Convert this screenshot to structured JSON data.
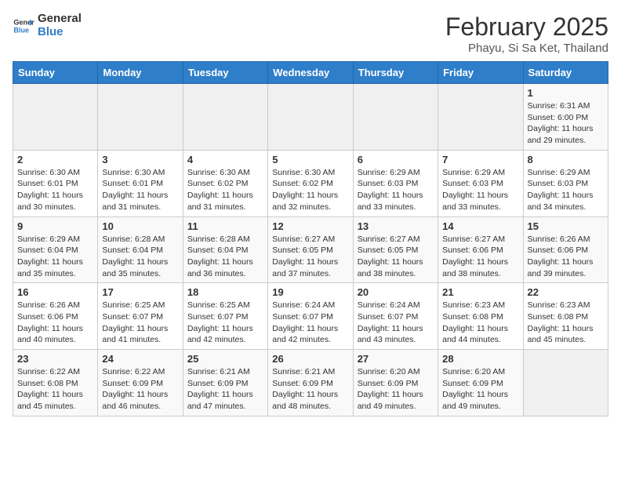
{
  "header": {
    "logo_general": "General",
    "logo_blue": "Blue",
    "title": "February 2025",
    "location": "Phayu, Si Sa Ket, Thailand"
  },
  "weekdays": [
    "Sunday",
    "Monday",
    "Tuesday",
    "Wednesday",
    "Thursday",
    "Friday",
    "Saturday"
  ],
  "weeks": [
    [
      {
        "day": "",
        "info": ""
      },
      {
        "day": "",
        "info": ""
      },
      {
        "day": "",
        "info": ""
      },
      {
        "day": "",
        "info": ""
      },
      {
        "day": "",
        "info": ""
      },
      {
        "day": "",
        "info": ""
      },
      {
        "day": "1",
        "info": "Sunrise: 6:31 AM\nSunset: 6:00 PM\nDaylight: 11 hours\nand 29 minutes."
      }
    ],
    [
      {
        "day": "2",
        "info": "Sunrise: 6:30 AM\nSunset: 6:01 PM\nDaylight: 11 hours\nand 30 minutes."
      },
      {
        "day": "3",
        "info": "Sunrise: 6:30 AM\nSunset: 6:01 PM\nDaylight: 11 hours\nand 31 minutes."
      },
      {
        "day": "4",
        "info": "Sunrise: 6:30 AM\nSunset: 6:02 PM\nDaylight: 11 hours\nand 31 minutes."
      },
      {
        "day": "5",
        "info": "Sunrise: 6:30 AM\nSunset: 6:02 PM\nDaylight: 11 hours\nand 32 minutes."
      },
      {
        "day": "6",
        "info": "Sunrise: 6:29 AM\nSunset: 6:03 PM\nDaylight: 11 hours\nand 33 minutes."
      },
      {
        "day": "7",
        "info": "Sunrise: 6:29 AM\nSunset: 6:03 PM\nDaylight: 11 hours\nand 33 minutes."
      },
      {
        "day": "8",
        "info": "Sunrise: 6:29 AM\nSunset: 6:03 PM\nDaylight: 11 hours\nand 34 minutes."
      }
    ],
    [
      {
        "day": "9",
        "info": "Sunrise: 6:29 AM\nSunset: 6:04 PM\nDaylight: 11 hours\nand 35 minutes."
      },
      {
        "day": "10",
        "info": "Sunrise: 6:28 AM\nSunset: 6:04 PM\nDaylight: 11 hours\nand 35 minutes."
      },
      {
        "day": "11",
        "info": "Sunrise: 6:28 AM\nSunset: 6:04 PM\nDaylight: 11 hours\nand 36 minutes."
      },
      {
        "day": "12",
        "info": "Sunrise: 6:27 AM\nSunset: 6:05 PM\nDaylight: 11 hours\nand 37 minutes."
      },
      {
        "day": "13",
        "info": "Sunrise: 6:27 AM\nSunset: 6:05 PM\nDaylight: 11 hours\nand 38 minutes."
      },
      {
        "day": "14",
        "info": "Sunrise: 6:27 AM\nSunset: 6:06 PM\nDaylight: 11 hours\nand 38 minutes."
      },
      {
        "day": "15",
        "info": "Sunrise: 6:26 AM\nSunset: 6:06 PM\nDaylight: 11 hours\nand 39 minutes."
      }
    ],
    [
      {
        "day": "16",
        "info": "Sunrise: 6:26 AM\nSunset: 6:06 PM\nDaylight: 11 hours\nand 40 minutes."
      },
      {
        "day": "17",
        "info": "Sunrise: 6:25 AM\nSunset: 6:07 PM\nDaylight: 11 hours\nand 41 minutes."
      },
      {
        "day": "18",
        "info": "Sunrise: 6:25 AM\nSunset: 6:07 PM\nDaylight: 11 hours\nand 42 minutes."
      },
      {
        "day": "19",
        "info": "Sunrise: 6:24 AM\nSunset: 6:07 PM\nDaylight: 11 hours\nand 42 minutes."
      },
      {
        "day": "20",
        "info": "Sunrise: 6:24 AM\nSunset: 6:07 PM\nDaylight: 11 hours\nand 43 minutes."
      },
      {
        "day": "21",
        "info": "Sunrise: 6:23 AM\nSunset: 6:08 PM\nDaylight: 11 hours\nand 44 minutes."
      },
      {
        "day": "22",
        "info": "Sunrise: 6:23 AM\nSunset: 6:08 PM\nDaylight: 11 hours\nand 45 minutes."
      }
    ],
    [
      {
        "day": "23",
        "info": "Sunrise: 6:22 AM\nSunset: 6:08 PM\nDaylight: 11 hours\nand 45 minutes."
      },
      {
        "day": "24",
        "info": "Sunrise: 6:22 AM\nSunset: 6:09 PM\nDaylight: 11 hours\nand 46 minutes."
      },
      {
        "day": "25",
        "info": "Sunrise: 6:21 AM\nSunset: 6:09 PM\nDaylight: 11 hours\nand 47 minutes."
      },
      {
        "day": "26",
        "info": "Sunrise: 6:21 AM\nSunset: 6:09 PM\nDaylight: 11 hours\nand 48 minutes."
      },
      {
        "day": "27",
        "info": "Sunrise: 6:20 AM\nSunset: 6:09 PM\nDaylight: 11 hours\nand 49 minutes."
      },
      {
        "day": "28",
        "info": "Sunrise: 6:20 AM\nSunset: 6:09 PM\nDaylight: 11 hours\nand 49 minutes."
      },
      {
        "day": "",
        "info": ""
      }
    ]
  ]
}
